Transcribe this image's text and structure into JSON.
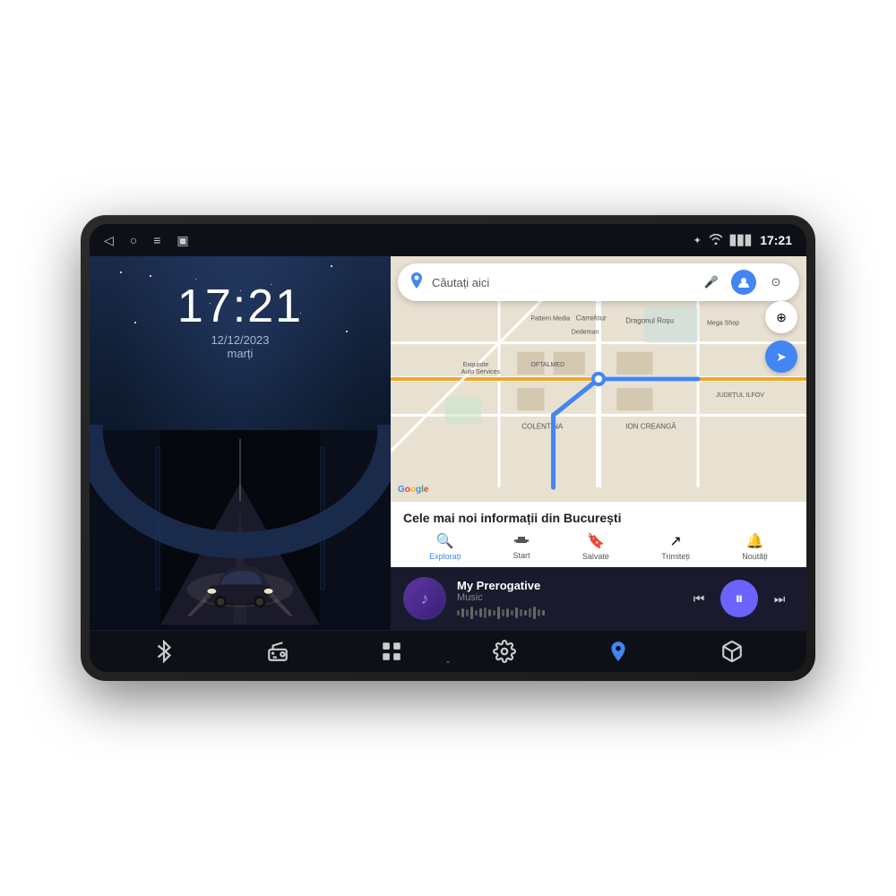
{
  "device": {
    "status_bar": {
      "time": "17:21",
      "nav_icons": [
        "◁",
        "○",
        "≡",
        "▣"
      ],
      "status_icons": [
        "bluetooth",
        "wifi",
        "signal"
      ]
    },
    "left_panel": {
      "clock_time": "17:21",
      "clock_date": "12/12/2023",
      "clock_day": "marți"
    },
    "right_panel": {
      "map": {
        "search_placeholder": "Căutați aici",
        "info_title": "Cele mai noi informații din București",
        "tabs": [
          {
            "label": "Explorați",
            "icon": "🔍",
            "active": true
          },
          {
            "label": "Start",
            "icon": "🚗",
            "active": false
          },
          {
            "label": "Salvate",
            "icon": "🔖",
            "active": false
          },
          {
            "label": "Trimiteți",
            "icon": "↗",
            "active": false
          },
          {
            "label": "Noutăți",
            "icon": "🔔",
            "active": false
          }
        ]
      },
      "music": {
        "song_title": "My Prerogative",
        "song_subtitle": "Music",
        "controls": {
          "prev_label": "⏮",
          "play_label": "⏸",
          "next_label": "⏭"
        }
      }
    },
    "bottom_nav": {
      "items": [
        {
          "icon": "bluetooth",
          "label": "bluetooth"
        },
        {
          "icon": "radio",
          "label": "radio"
        },
        {
          "icon": "grid",
          "label": "apps"
        },
        {
          "icon": "settings",
          "label": "settings"
        },
        {
          "icon": "maps",
          "label": "google-maps"
        },
        {
          "icon": "cube",
          "label": "extra"
        }
      ]
    }
  }
}
